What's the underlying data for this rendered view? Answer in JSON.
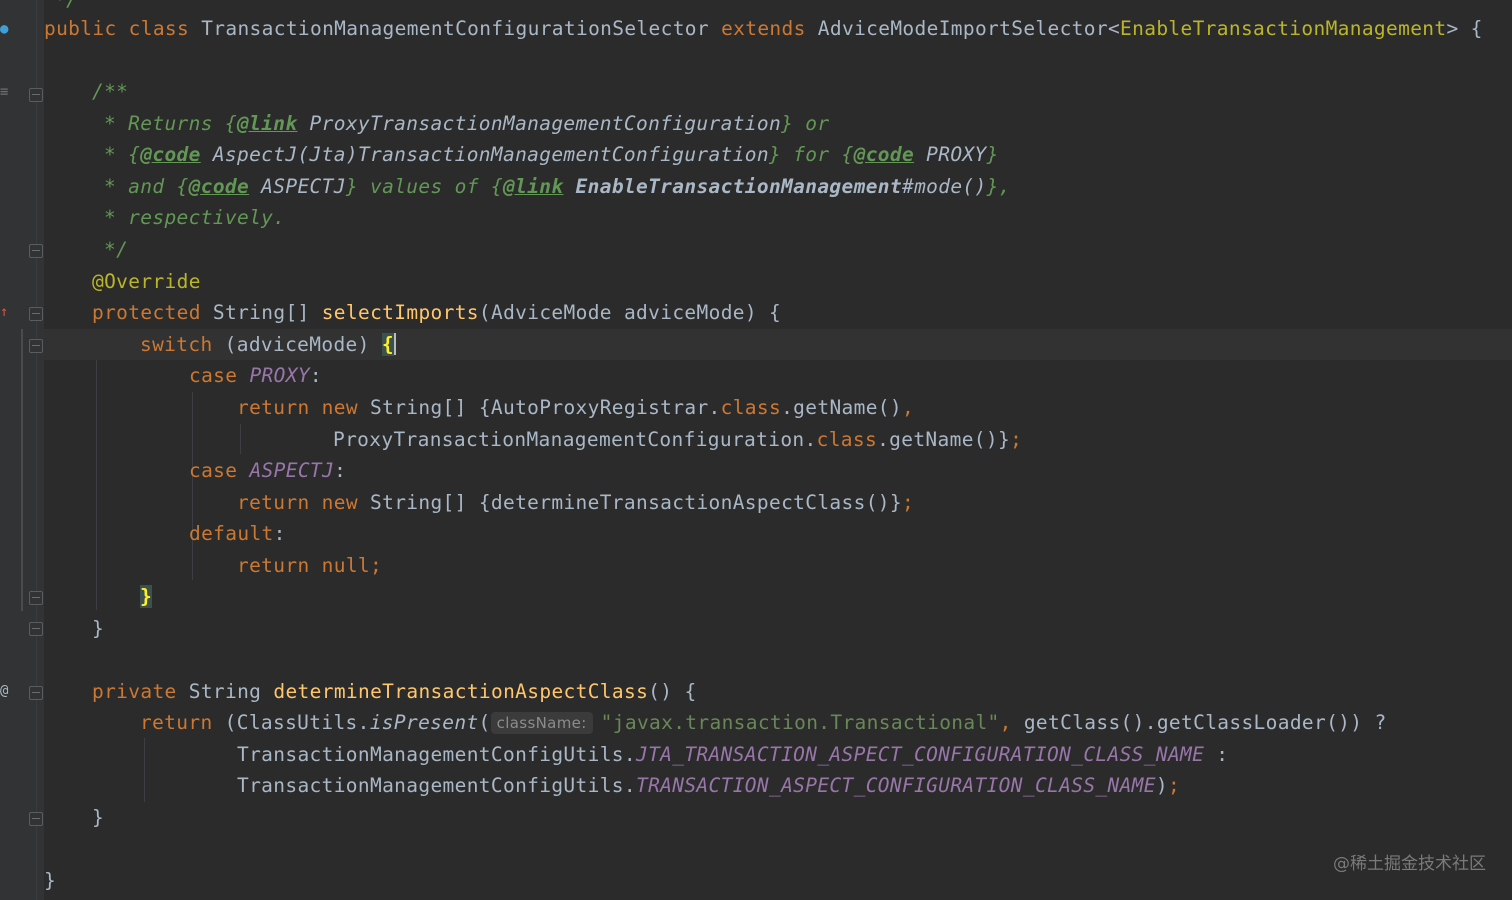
{
  "code": {
    "top_partial": "*/",
    "l01": {
      "kw1": "public",
      "kw2": "class",
      "name": "TransactionManagementConfigurationSelector",
      "kw3": "extends",
      "base": "AdviceModeImportSelector<",
      "generic": "EnableTransactionManagement",
      "end": "> {"
    },
    "l03": "/**",
    "l04": {
      "a": "* Returns ",
      "b": "{",
      "tag": "@link",
      "ref": " ProxyTransactionManagementConfiguration",
      "c": "} or"
    },
    "l05": {
      "a": "* {",
      "tag1": "@code",
      "ref1": " AspectJ(Jta)TransactionManagementConfiguration",
      "b": "} for {",
      "tag2": "@code",
      "ref2": " PROXY",
      "c": "}"
    },
    "l06": {
      "a": "* and {",
      "tag1": "@code",
      "ref1": " ASPECTJ",
      "b": "} values of {",
      "tag2": "@link",
      "ref2": " EnableTransactionManagement",
      "ref3": "#mode()",
      "c": "},"
    },
    "l07": "* respectively.",
    "l08": "*/",
    "l09": "@Override",
    "l10": {
      "kw": "protected",
      "type": " String[] ",
      "fn": "selectImports",
      "rest": "(AdviceMode adviceMode) {"
    },
    "l11": {
      "kw": "switch",
      "rest": " (adviceMode) ",
      "brace": "{"
    },
    "l12": {
      "kw": "case",
      "enum": "PROXY",
      "colon": ":"
    },
    "l13": {
      "kw1": "return",
      "kw2": "new",
      "a": " String[] {AutoProxyRegistrar.",
      "kw3": "class",
      "b": ".getName()",
      "comma": ","
    },
    "l14": {
      "a": "ProxyTransactionManagementConfiguration.",
      "kw": "class",
      "b": ".getName()}",
      "semi": ";"
    },
    "l15": {
      "kw": "case",
      "enum": "ASPECTJ",
      "colon": ":"
    },
    "l16": {
      "kw1": "return",
      "kw2": "new",
      "a": " String[] {determineTransactionAspectClass()}",
      "semi": ";"
    },
    "l17": {
      "kw": "default",
      "colon": ":"
    },
    "l18": {
      "kw1": "return",
      "kw2": "null",
      "semi": ";"
    },
    "l19": "}",
    "l20": "}",
    "l22": {
      "kw": "private",
      "type": " String ",
      "fn": "determineTransactionAspectClass",
      "rest": "() {"
    },
    "l23": {
      "kw": "return",
      "a": " (ClassUtils.",
      "static": "isPresent",
      "b": "(",
      "hint": "className:",
      "str": "\"javax.transaction.Transactional\"",
      "comma": ",",
      "c": " getClass().getClassLoader()) ?"
    },
    "l24": {
      "a": "TransactionManagementConfigUtils.",
      "const": "JTA_TRANSACTION_ASPECT_CONFIGURATION_CLASS_NAME",
      "b": " :"
    },
    "l25": {
      "a": "TransactionManagementConfigUtils.",
      "const": "TRANSACTION_ASPECT_CONFIGURATION_CLASS_NAME",
      "b": ")",
      "semi": ";"
    },
    "l26": "}",
    "l28": "}"
  },
  "watermark": "@稀土掘金技术社区",
  "colors": {
    "background": "#2b2b2b",
    "keyword": "#cc7832",
    "annotation": "#bbb529",
    "method": "#ffc66d",
    "doc_comment": "#629755",
    "constant": "#9876aa",
    "string": "#6a8759"
  }
}
